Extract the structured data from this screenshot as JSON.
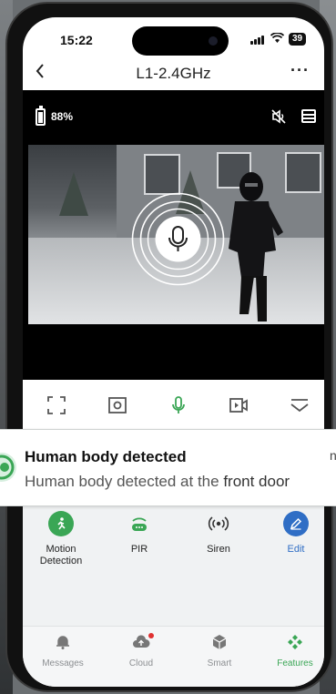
{
  "status_bar": {
    "time": "15:22",
    "battery": "39"
  },
  "nav": {
    "back": "‹",
    "title": "L1-2.4GHz",
    "more": "···"
  },
  "live": {
    "battery_level": "88%"
  },
  "notification": {
    "title": "Human body detected",
    "body_prefix": "Human body detected at the ",
    "body_emphasis": "front door",
    "time": "n"
  },
  "controls": [
    {
      "label": "Motion\nDetection",
      "icon": "motion-detection-icon"
    },
    {
      "label": "PIR",
      "icon": "pir-icon"
    },
    {
      "label": "Siren",
      "icon": "siren-icon"
    },
    {
      "label": "Edit",
      "icon": "edit-icon"
    }
  ],
  "tabs": [
    {
      "label": "Messages",
      "icon": "bell-icon"
    },
    {
      "label": "Cloud",
      "icon": "cloud-icon"
    },
    {
      "label": "Smart",
      "icon": "cube-icon"
    },
    {
      "label": "Features",
      "icon": "features-icon",
      "active": true
    }
  ],
  "colors": {
    "accent_green": "#3aa655",
    "edit_blue": "#2f6ec5"
  }
}
